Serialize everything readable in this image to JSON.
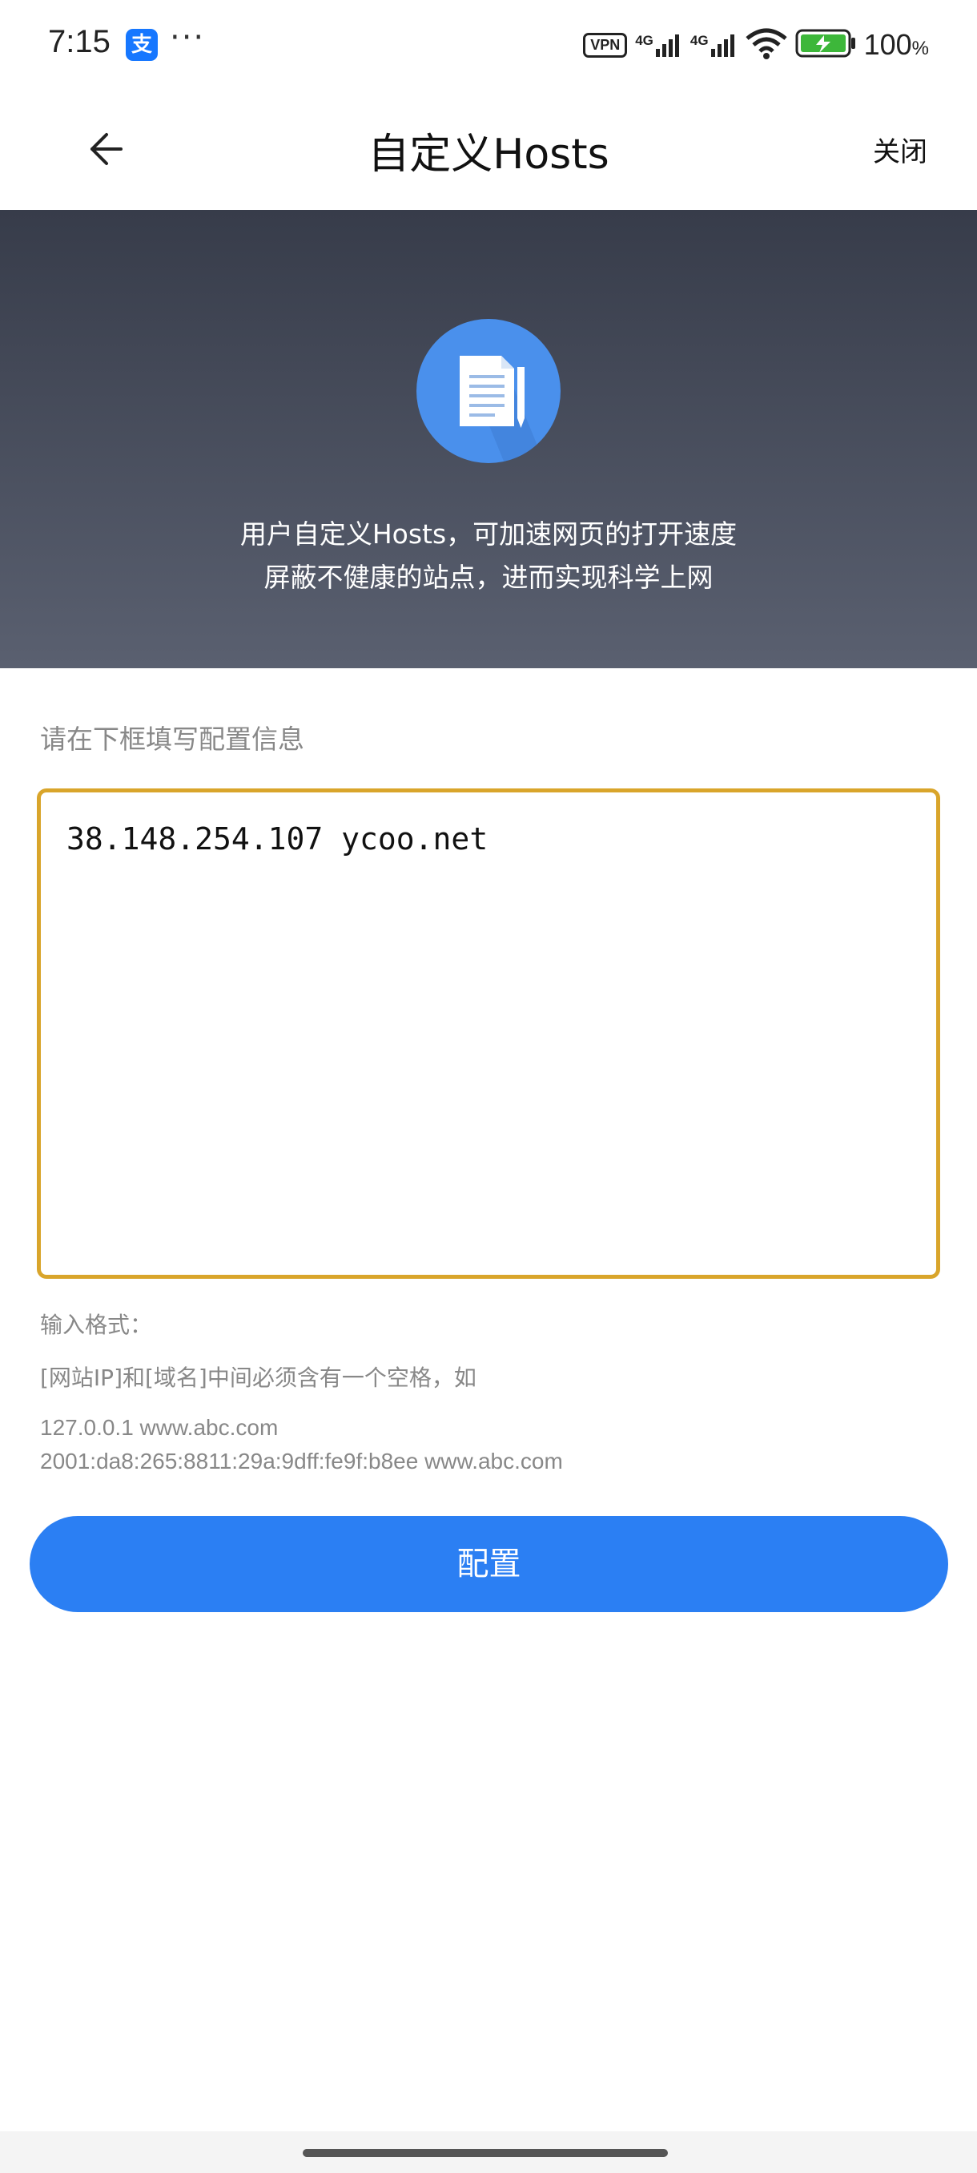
{
  "status_bar": {
    "time": "7:15",
    "alipay_glyph": "支",
    "dots": "···",
    "vpn": "VPN",
    "net1": "4G",
    "net2": "4G",
    "battery_pct": "100",
    "battery_unit": "%"
  },
  "nav": {
    "title": "自定义Hosts",
    "close_label": "关闭"
  },
  "banner": {
    "line1": "用户自定义Hosts，可加速网页的打开速度",
    "line2": "屏蔽不健康的站点，进而实现科学上网"
  },
  "form": {
    "label": "请在下框填写配置信息",
    "input_value": "38.148.254.107 ycoo.net",
    "format_title": "输入格式：",
    "format_desc": "[网站IP]和[域名]中间必须含有一个空格，如",
    "example1": "127.0.0.1 www.abc.com",
    "example2": "2001:da8:265:8811:29a:9dff:fe9f:b8ee www.abc.com",
    "submit_label": "配置"
  },
  "colors": {
    "accent": "#2b7ff3",
    "input_border": "#d9a52b",
    "banner_top": "#373c4a",
    "banner_bottom": "#5a6070"
  }
}
